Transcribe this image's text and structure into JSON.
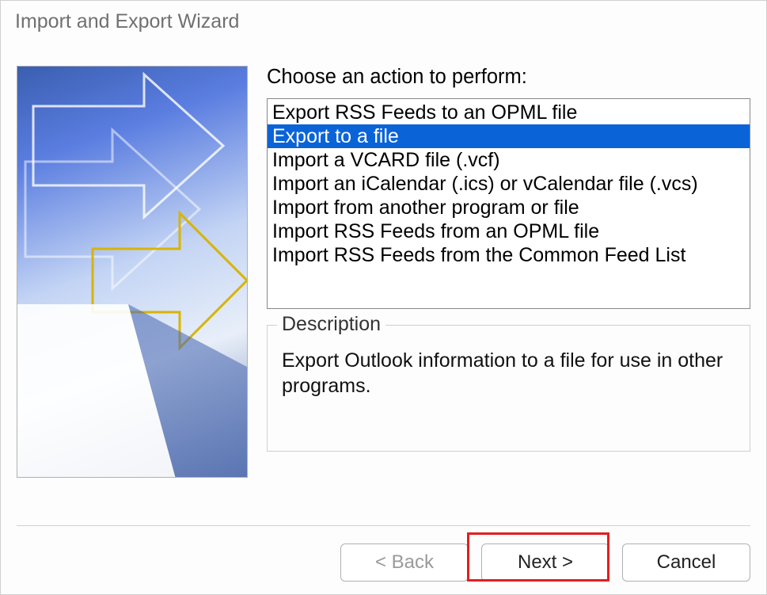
{
  "window": {
    "title": "Import and Export Wizard"
  },
  "main": {
    "prompt": "Choose an action to perform:",
    "items": {
      "0": "Export RSS Feeds to an OPML file",
      "1": "Export to a file",
      "2": "Import a VCARD file (.vcf)",
      "3": "Import an iCalendar (.ics) or vCalendar file (.vcs)",
      "4": "Import from another program or file",
      "5": "Import RSS Feeds from an OPML file",
      "6": "Import RSS Feeds from the Common Feed List"
    },
    "selected_index": 1
  },
  "description": {
    "legend": "Description",
    "text": "Export Outlook information to a file for use in other programs."
  },
  "footer": {
    "back": "< Back",
    "next": "Next >",
    "cancel": "Cancel"
  }
}
